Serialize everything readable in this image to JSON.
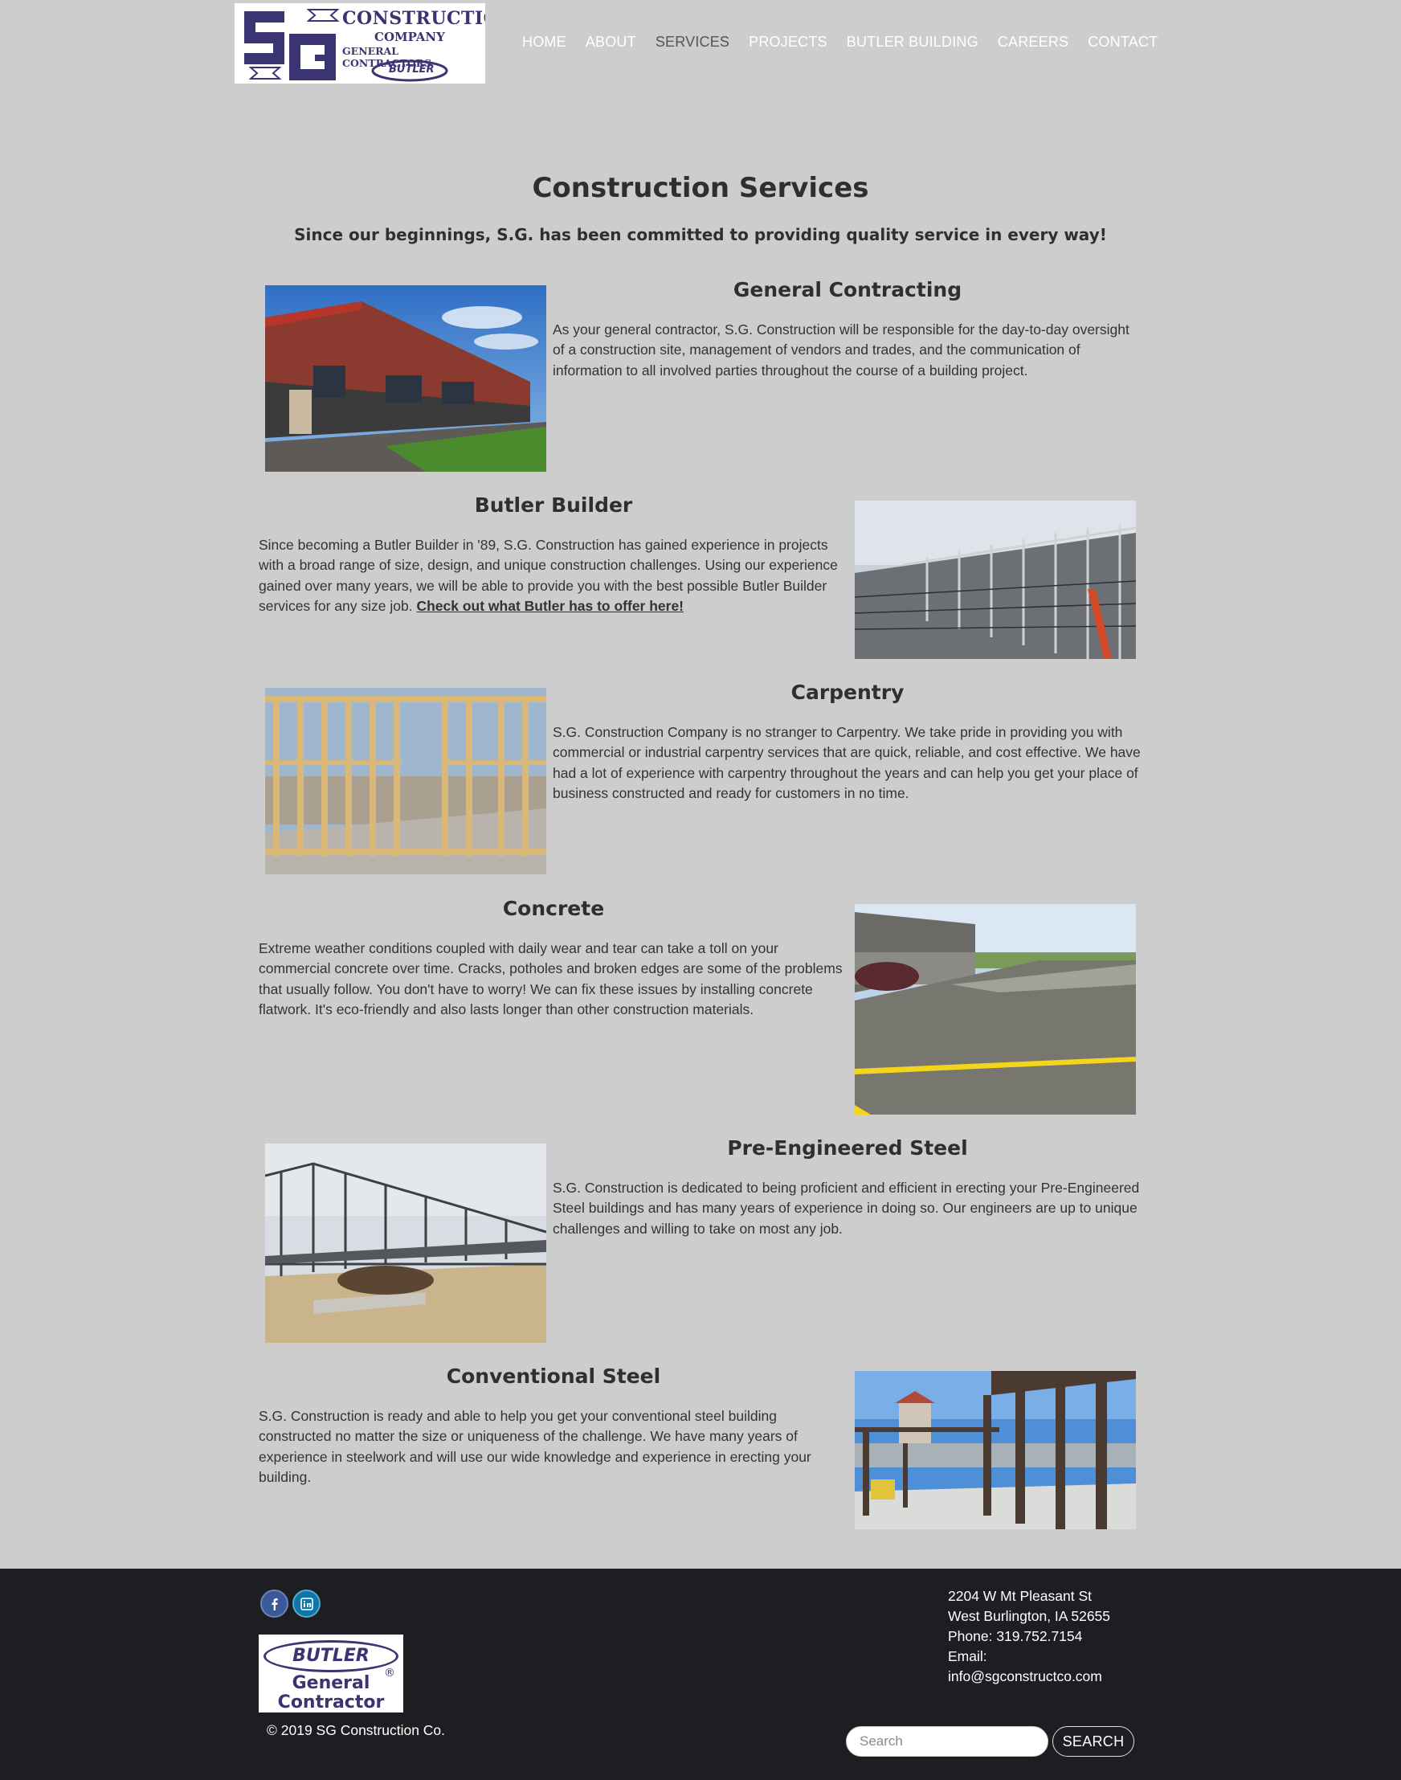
{
  "header": {
    "logo": {
      "letters": "SG",
      "line1": "CONSTRUCTION",
      "line2": "COMPANY",
      "line3": "GENERAL CONTRACTORS",
      "badge": "BUTLER"
    },
    "nav": [
      {
        "label": "HOME"
      },
      {
        "label": "ABOUT"
      },
      {
        "label": "SERVICES"
      },
      {
        "label": "PROJECTS"
      },
      {
        "label": "BUTLER BUILDING"
      },
      {
        "label": "CAREERS"
      },
      {
        "label": "CONTACT"
      }
    ],
    "active_nav": "SERVICES"
  },
  "main": {
    "title": "Construction Services",
    "subtitle": "Since our beginnings, S.G. has been committed to providing quality service in every way!",
    "sections": [
      {
        "title": "General Contracting",
        "body": "As your general contractor, S.G. Construction will be responsible for the day-to-day oversight of a construction site, management of vendors and trades, and the communication of information to all involved parties throughout the course of a building project."
      },
      {
        "title": "Butler Builder",
        "body": "Since becoming a Butler Builder in '89, S.G. Construction has gained experience in projects with a broad range of size, design, and unique construction challenges. Using our experience gained over many years, we will be able to provide you with the best possible Butler Builder services for any size job. ",
        "link": "Check out what Butler has to offer here!"
      },
      {
        "title": "Carpentry",
        "body": "S.G. Construction Company is no stranger to Carpentry. We take pride in providing you with commercial or industrial carpentry services that are quick, reliable, and cost effective. We have had a lot of experience with carpentry throughout the years and can help you get your place of business constructed and ready for customers in no time."
      },
      {
        "title": "Concrete",
        "body": "Extreme weather conditions coupled with daily wear and tear can take a toll on your commercial concrete over time. Cracks, potholes and broken edges are some of the problems that usually follow. You don't have to worry! We can fix these issues by installing concrete flatwork. It's eco-friendly and also lasts longer than other construction materials."
      },
      {
        "title": "Pre-Engineered Steel",
        "body": "S.G. Construction is dedicated to being proficient and efficient in erecting your Pre-Engineered Steel buildings and has many years of experience in doing so. Our engineers are up to unique challenges and willing to take on most any job."
      },
      {
        "title": "Conventional Steel",
        "body": "S.G. Construction is ready and able to help you get your conventional steel building constructed no matter the size or uniqueness of the challenge. We have many years of experience in steelwork and will use our wide knowledge and experience in erecting your building."
      }
    ]
  },
  "footer": {
    "social": [
      {
        "icon": "facebook-icon"
      },
      {
        "icon": "linkedin-icon"
      }
    ],
    "butler_logo": {
      "name": "BUTLER",
      "reg": "®",
      "line1": "General",
      "line2": "Contractor"
    },
    "copyright": "© 2019 SG Construction Co.",
    "address": {
      "street": "2204 W Mt Pleasant St",
      "city": "West Burlington, IA 52655",
      "phone": "Phone: 319.752.7154",
      "email_label": "Email:",
      "email": "info@sgconstructco.com"
    },
    "search": {
      "placeholder": "Search",
      "button": "SEARCH"
    }
  },
  "colors": {
    "page_bg": "#cdcdcd",
    "footer_bg": "#1c1e21",
    "brand_purple": "#3a3572",
    "nav_text": "#ffffff",
    "nav_active": "#555555"
  }
}
